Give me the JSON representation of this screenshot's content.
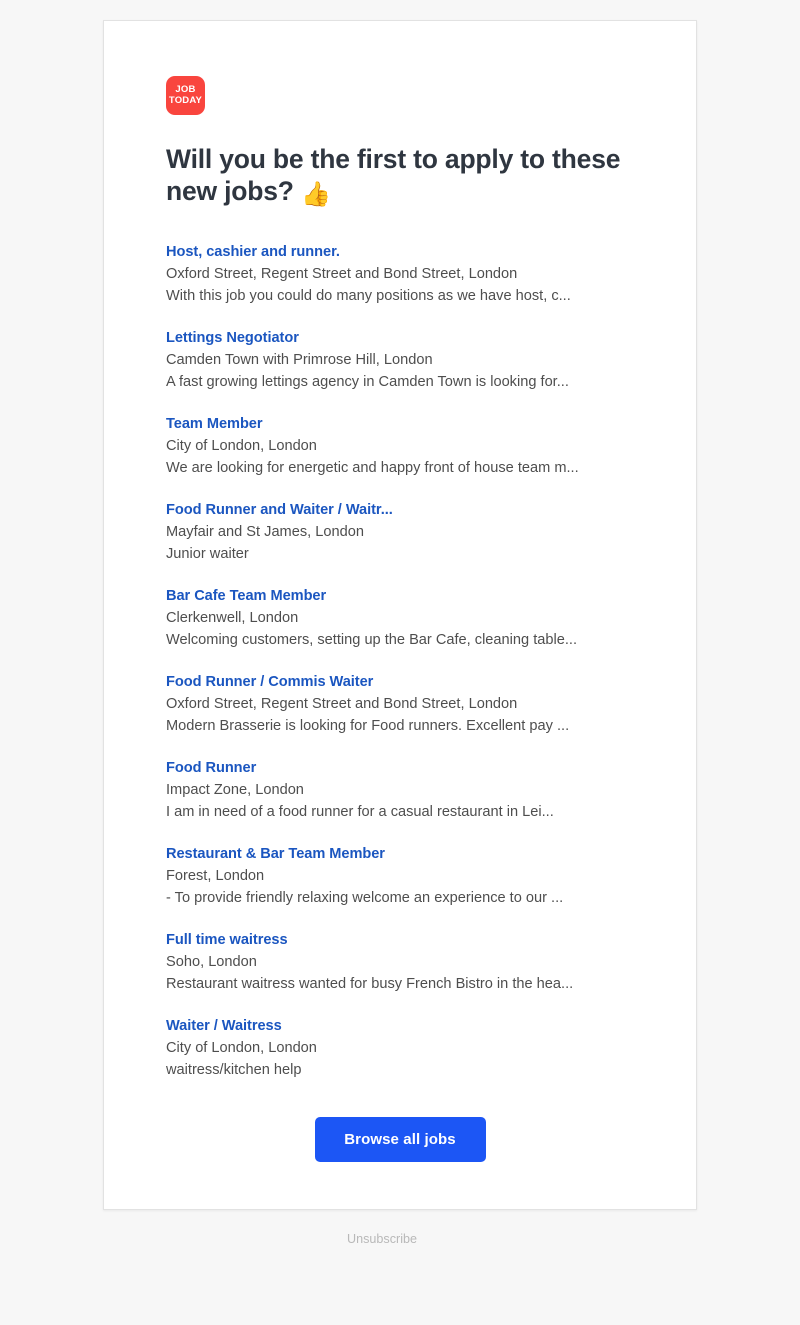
{
  "brand": {
    "logo_line1": "JOB",
    "logo_line2": "TODAY",
    "logo_color": "#f9453e"
  },
  "headline": {
    "text": "Will you be the first to apply to these new jobs? ",
    "emoji": "👍"
  },
  "jobs": [
    {
      "title": "Host, cashier and runner.",
      "location": "Oxford Street, Regent Street and Bond Street, London",
      "description": "With this job you could do many positions as we have host, c..."
    },
    {
      "title": "Lettings Negotiator",
      "location": "Camden Town with Primrose Hill, London",
      "description": "A fast growing lettings agency in Camden Town is looking for..."
    },
    {
      "title": "Team Member",
      "location": "City of London, London",
      "description": "We are looking for energetic and happy front of house team m..."
    },
    {
      "title": "Food Runner and Waiter / Waitr...",
      "location": "Mayfair and St James, London",
      "description": "Junior waiter"
    },
    {
      "title": "Bar Cafe Team Member",
      "location": "Clerkenwell, London",
      "description": "Welcoming customers, setting up the Bar Cafe, cleaning table..."
    },
    {
      "title": "Food Runner / Commis Waiter",
      "location": "Oxford Street, Regent Street and Bond Street, London",
      "description": "Modern Brasserie is looking for Food runners. Excellent pay ..."
    },
    {
      "title": "Food Runner",
      "location": "Impact Zone, London",
      "description": "I am in need of a food runner for a casual restaurant in Lei..."
    },
    {
      "title": "Restaurant & Bar Team Member",
      "location": "Forest, London",
      "description": "- To provide friendly relaxing welcome an experience to our ..."
    },
    {
      "title": "Full time waitress",
      "location": "Soho, London",
      "description": "Restaurant waitress wanted for busy French Bistro in the hea..."
    },
    {
      "title": "Waiter / Waitress",
      "location": "City of London, London",
      "description": "waitress/kitchen help"
    }
  ],
  "cta": {
    "label": "Browse all jobs",
    "color": "#1c56f5"
  },
  "footer": {
    "unsubscribe_label": "Unsubscribe"
  }
}
